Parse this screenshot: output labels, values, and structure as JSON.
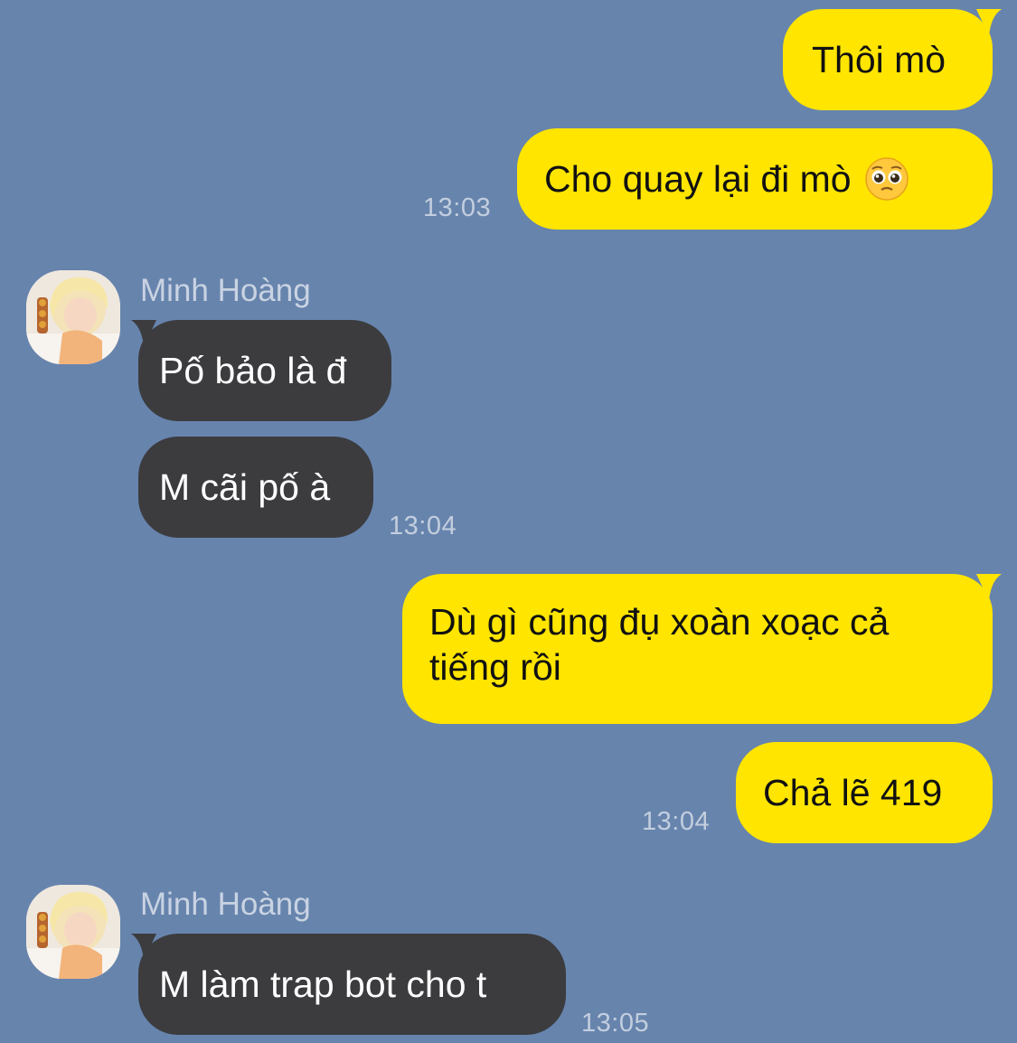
{
  "contact": {
    "name": "Minh Hoàng"
  },
  "messages": [
    {
      "direction": "outgoing",
      "text": "Thôi mò"
    },
    {
      "direction": "outgoing",
      "text": "Cho quay lại đi mò",
      "emoji": "pleading-face",
      "time": "13:03"
    },
    {
      "direction": "incoming",
      "sender": "Minh Hoàng",
      "text": "Pố bảo là đ"
    },
    {
      "direction": "incoming",
      "text": "M cãi pố à",
      "time": "13:04"
    },
    {
      "direction": "outgoing",
      "text": "Dù gì cũng đụ xoàn xoạc cả tiếng rồi"
    },
    {
      "direction": "outgoing",
      "text": "Chả lẽ 419",
      "time": "13:04"
    },
    {
      "direction": "incoming",
      "sender": "Minh Hoàng",
      "text": "M làm trap bot cho t",
      "time": "13:05"
    }
  ],
  "colors": {
    "background": "#6784AD",
    "outgoing_bubble": "#FFE500",
    "incoming_bubble": "#3C3C3F",
    "timestamp": "#C3CEDE"
  },
  "icons": {
    "avatar": "profile-photo",
    "emoji": "pleading-face-emoji"
  }
}
